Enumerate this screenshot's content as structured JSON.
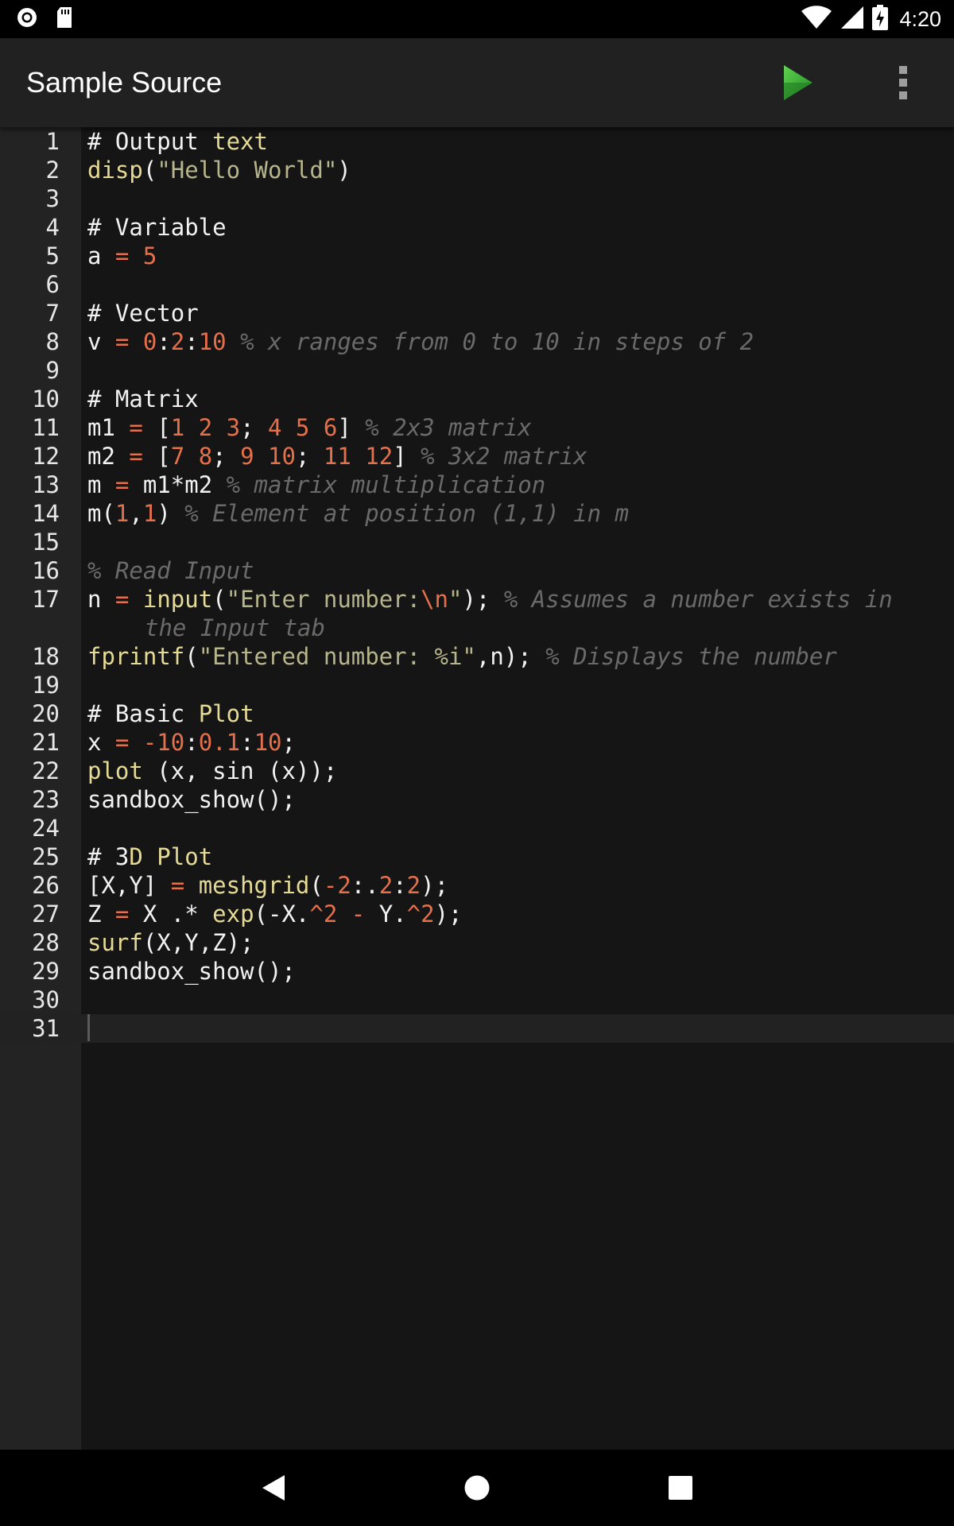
{
  "status_bar": {
    "time": "4:20",
    "icons": [
      "record-icon",
      "sd-card-icon",
      "wifi-icon",
      "cellular-signal-icon",
      "battery-charging-icon"
    ]
  },
  "app_bar": {
    "title": "Sample Source",
    "run_icon": "play-icon",
    "menu_icon": "more-vert-icon",
    "run_color": "#3fb13a"
  },
  "editor": {
    "current_line": 31,
    "lines": [
      {
        "n": "1",
        "tokens": [
          [
            "plain",
            "# Output "
          ],
          [
            "fn",
            "text"
          ]
        ]
      },
      {
        "n": "2",
        "tokens": [
          [
            "fn",
            "disp"
          ],
          [
            "plain",
            "("
          ],
          [
            "str",
            "\"Hello World\""
          ],
          [
            "plain",
            ")"
          ]
        ]
      },
      {
        "n": "3",
        "tokens": []
      },
      {
        "n": "4",
        "tokens": [
          [
            "plain",
            "# Variable"
          ]
        ]
      },
      {
        "n": "5",
        "tokens": [
          [
            "plain",
            "a "
          ],
          [
            "num",
            "= 5"
          ]
        ]
      },
      {
        "n": "6",
        "tokens": []
      },
      {
        "n": "7",
        "tokens": [
          [
            "plain",
            "# Vector"
          ]
        ]
      },
      {
        "n": "8",
        "tokens": [
          [
            "plain",
            "v "
          ],
          [
            "num",
            "= 0"
          ],
          [
            "plain",
            ":"
          ],
          [
            "num",
            "2"
          ],
          [
            "plain",
            ":"
          ],
          [
            "num",
            "10"
          ],
          [
            "plain",
            " "
          ],
          [
            "cm",
            "% x ranges from 0 to 10 in steps of 2"
          ]
        ]
      },
      {
        "n": "9",
        "tokens": []
      },
      {
        "n": "10",
        "tokens": [
          [
            "plain",
            "# Matrix"
          ]
        ]
      },
      {
        "n": "11",
        "tokens": [
          [
            "plain",
            "m1 "
          ],
          [
            "num",
            "="
          ],
          [
            "plain",
            " ["
          ],
          [
            "num",
            "1 2 3"
          ],
          [
            "plain",
            "; "
          ],
          [
            "num",
            "4 5 6"
          ],
          [
            "plain",
            "] "
          ],
          [
            "cm",
            "% 2x3 matrix"
          ]
        ]
      },
      {
        "n": "12",
        "tokens": [
          [
            "plain",
            "m2 "
          ],
          [
            "num",
            "="
          ],
          [
            "plain",
            " ["
          ],
          [
            "num",
            "7 8"
          ],
          [
            "plain",
            "; "
          ],
          [
            "num",
            "9 10"
          ],
          [
            "plain",
            "; "
          ],
          [
            "num",
            "11 12"
          ],
          [
            "plain",
            "] "
          ],
          [
            "cm",
            "% 3x2 matrix"
          ]
        ]
      },
      {
        "n": "13",
        "tokens": [
          [
            "plain",
            "m "
          ],
          [
            "num",
            "="
          ],
          [
            "plain",
            " m1*m2 "
          ],
          [
            "cm",
            "% matrix multiplication"
          ]
        ]
      },
      {
        "n": "14",
        "tokens": [
          [
            "plain",
            "m("
          ],
          [
            "num",
            "1"
          ],
          [
            "plain",
            ","
          ],
          [
            "num",
            "1"
          ],
          [
            "plain",
            ") "
          ],
          [
            "cm",
            "% Element at position (1,1) in m"
          ]
        ]
      },
      {
        "n": "15",
        "tokens": []
      },
      {
        "n": "16",
        "tokens": [
          [
            "cm",
            "% Read Input"
          ]
        ]
      },
      {
        "n": "17",
        "wrap": true,
        "tokens": [
          [
            "plain",
            "n "
          ],
          [
            "num",
            "="
          ],
          [
            "plain",
            " "
          ],
          [
            "fn",
            "input"
          ],
          [
            "plain",
            "("
          ],
          [
            "str",
            "\"Enter number:"
          ],
          [
            "num",
            "\\n"
          ],
          [
            "str",
            "\""
          ],
          [
            "plain",
            "); "
          ],
          [
            "cm",
            "% Assumes a number exists in"
          ]
        ],
        "continuation": [
          [
            "cm",
            "the Input tab"
          ]
        ]
      },
      {
        "n": "18",
        "tokens": [
          [
            "fn",
            "fprintf"
          ],
          [
            "plain",
            "("
          ],
          [
            "str",
            "\"Entered number: %i\""
          ],
          [
            "plain",
            ",n); "
          ],
          [
            "cm",
            "% Displays the number"
          ]
        ]
      },
      {
        "n": "19",
        "tokens": []
      },
      {
        "n": "20",
        "tokens": [
          [
            "plain",
            "# Basic "
          ],
          [
            "fn",
            "Plot"
          ]
        ]
      },
      {
        "n": "21",
        "tokens": [
          [
            "plain",
            "x "
          ],
          [
            "num",
            "= -10"
          ],
          [
            "plain",
            ":"
          ],
          [
            "num",
            "0.1"
          ],
          [
            "plain",
            ":"
          ],
          [
            "num",
            "10"
          ],
          [
            "plain",
            ";"
          ]
        ]
      },
      {
        "n": "22",
        "tokens": [
          [
            "fn",
            "plot"
          ],
          [
            "plain",
            " (x, sin (x));"
          ]
        ]
      },
      {
        "n": "23",
        "tokens": [
          [
            "plain",
            "sandbox_show();"
          ]
        ]
      },
      {
        "n": "24",
        "tokens": []
      },
      {
        "n": "25",
        "tokens": [
          [
            "plain",
            "# 3"
          ],
          [
            "fn",
            "D Plot"
          ]
        ]
      },
      {
        "n": "26",
        "tokens": [
          [
            "plain",
            "[X,Y] "
          ],
          [
            "num",
            "="
          ],
          [
            "plain",
            " "
          ],
          [
            "fn",
            "meshgrid"
          ],
          [
            "plain",
            "("
          ],
          [
            "num",
            "-2"
          ],
          [
            "plain",
            ":."
          ],
          [
            "num",
            "2"
          ],
          [
            "plain",
            ":"
          ],
          [
            "num",
            "2"
          ],
          [
            "plain",
            ");"
          ]
        ]
      },
      {
        "n": "27",
        "tokens": [
          [
            "plain",
            "Z "
          ],
          [
            "num",
            "="
          ],
          [
            "plain",
            " X .* "
          ],
          [
            "fn",
            "exp"
          ],
          [
            "plain",
            "(-X."
          ],
          [
            "num",
            "^2"
          ],
          [
            "plain",
            " "
          ],
          [
            "num",
            "-"
          ],
          [
            "plain",
            " Y."
          ],
          [
            "num",
            "^2"
          ],
          [
            "plain",
            ");"
          ]
        ]
      },
      {
        "n": "28",
        "tokens": [
          [
            "fn",
            "surf"
          ],
          [
            "plain",
            "(X,Y,Z);"
          ]
        ]
      },
      {
        "n": "29",
        "tokens": [
          [
            "plain",
            "sandbox_show();"
          ]
        ]
      },
      {
        "n": "30",
        "tokens": []
      },
      {
        "n": "31",
        "tokens": [],
        "cursor": true
      }
    ]
  },
  "nav_bar": {
    "back_icon": "back-triangle-icon",
    "home_icon": "home-circle-icon",
    "recents_icon": "recents-square-icon"
  }
}
